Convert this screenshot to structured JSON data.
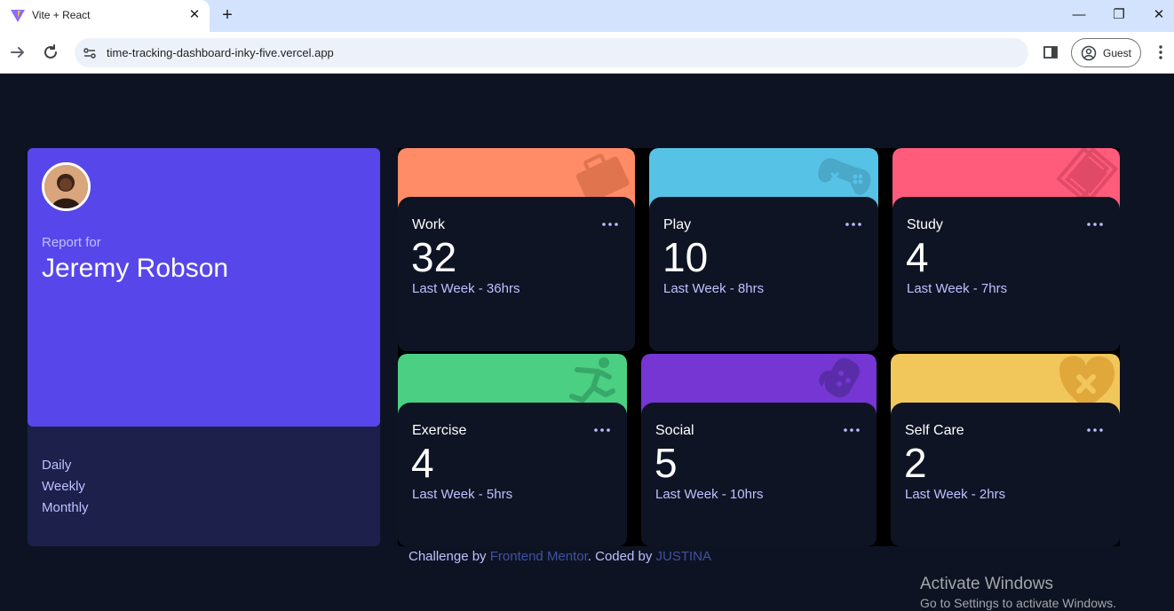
{
  "browser": {
    "tab_title": "Vite + React",
    "url": "time-tracking-dashboard-inky-five.vercel.app",
    "profile_label": "Guest"
  },
  "profile": {
    "report_for": "Report for",
    "name": "Jeremy Robson",
    "periods": [
      "Daily",
      "Weekly",
      "Monthly"
    ]
  },
  "cards": [
    {
      "title": "Work",
      "hours": "32",
      "previous": "Last Week - 36hrs",
      "color": "#ff8c66",
      "icon": "briefcase-icon"
    },
    {
      "title": "Play",
      "hours": "10",
      "previous": "Last Week - 8hrs",
      "color": "#56c2e6",
      "icon": "gamepad-icon"
    },
    {
      "title": "Study",
      "hours": "4",
      "previous": "Last Week - 7hrs",
      "color": "#ff5c7c",
      "icon": "book-icon"
    },
    {
      "title": "Exercise",
      "hours": "4",
      "previous": "Last Week - 5hrs",
      "color": "#4bcf83",
      "icon": "running-icon"
    },
    {
      "title": "Social",
      "hours": "5",
      "previous": "Last Week - 10hrs",
      "color": "#7536d3",
      "icon": "social-icon"
    },
    {
      "title": "Self Care",
      "hours": "2",
      "previous": "Last Week - 2hrs",
      "color": "#f1c65b",
      "icon": "heart-icon"
    }
  ],
  "footer": {
    "prefix": "Challenge by ",
    "link1": "Frontend Mentor",
    "middle": ". Coded by ",
    "link2": "JUSTINA"
  },
  "watermark": {
    "title": "Activate Windows",
    "subtitle": "Go to Settings to activate Windows."
  }
}
